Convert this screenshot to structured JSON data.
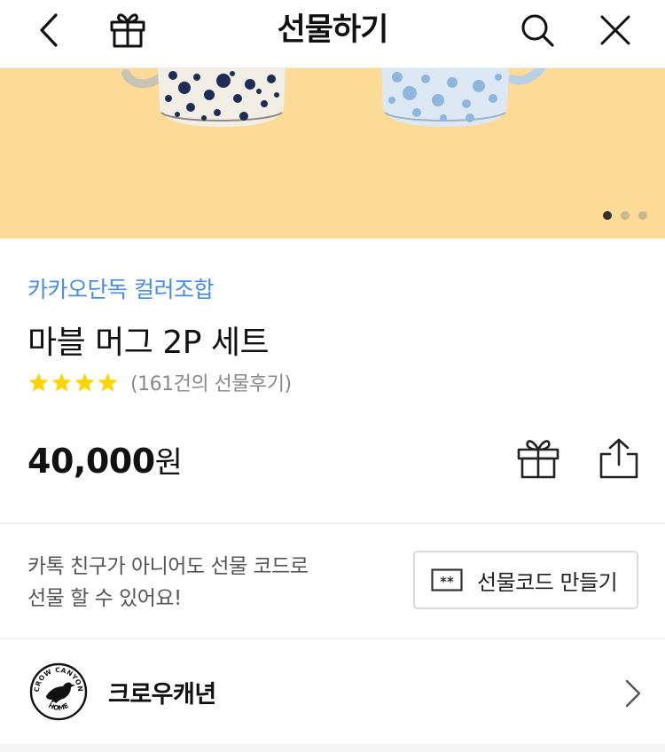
{
  "header": {
    "title": "선물하기",
    "icons": {
      "back": "chevron-left-icon",
      "gift": "gift-icon",
      "search": "search-icon",
      "close": "close-icon"
    }
  },
  "banner": {
    "slide_count": 3,
    "active_slide": 1,
    "background": "#fbdb95"
  },
  "product": {
    "brand": "카카오단독 컬러조합",
    "name": "마블 머그 2P 세트",
    "rating": 4,
    "review_text": "(161건의 선물후기)",
    "price": "40,000",
    "currency": "원",
    "brand_color": "#4a8ce0",
    "star_color": "#ffd400"
  },
  "gift_code": {
    "line1": "카톡 친구가 아니어도 선물 코드로",
    "line2": "선물 할 수 있어요!",
    "button_label": "선물코드 만들기"
  },
  "seller": {
    "name": "크로우캐년",
    "logo_text_top": "CROW CANYON",
    "logo_text_bottom": "HOME"
  }
}
